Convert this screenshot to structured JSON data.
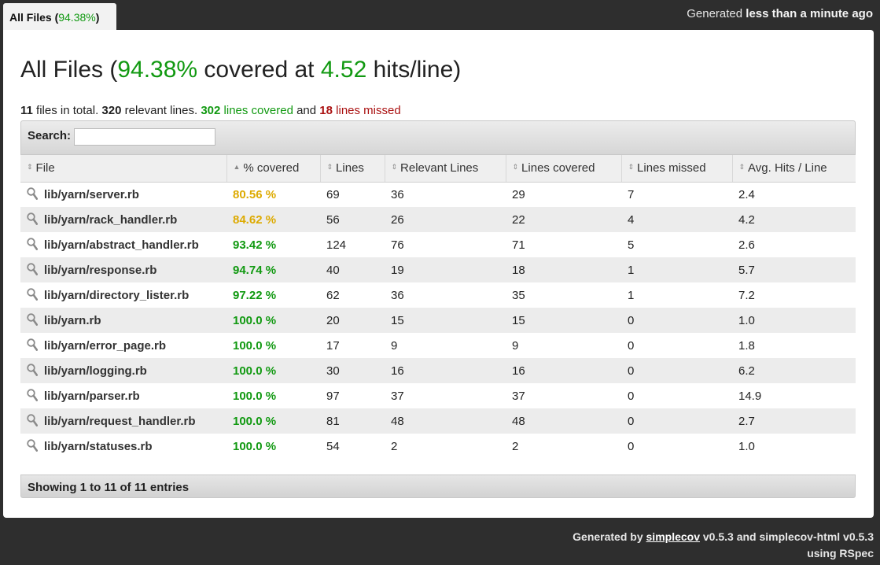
{
  "tab": {
    "label_prefix": "All Files (",
    "pct": "94.38%",
    "label_suffix": ")"
  },
  "generated": {
    "prefix": "Generated",
    "time": "less than a minute ago"
  },
  "heading": {
    "prefix": "All Files (",
    "pct": "94.38%",
    "middle": " covered at ",
    "hits": "4.52",
    "suffix": " hits/line)"
  },
  "summary": {
    "files_count": "11",
    "files_text": " files in total. ",
    "relevant_count": "320",
    "relevant_text": " relevant lines. ",
    "covered_count": "302",
    "covered_text": " lines covered",
    "and_text": " and ",
    "missed_count": "18",
    "missed_text": " lines missed"
  },
  "search": {
    "label": "Search:",
    "value": ""
  },
  "table": {
    "columns": [
      "File",
      "% covered",
      "Lines",
      "Relevant Lines",
      "Lines covered",
      "Lines missed",
      "Avg. Hits / Line"
    ],
    "sort_icons": [
      "⇕",
      "▲",
      "⇕",
      "⇕",
      "⇕",
      "⇕",
      "⇕"
    ],
    "rows": [
      {
        "file": "lib/yarn/server.rb",
        "pct": "80.56 %",
        "lines": "69",
        "relevant": "36",
        "covered": "29",
        "missed": "7",
        "avg": "2.4"
      },
      {
        "file": "lib/yarn/rack_handler.rb",
        "pct": "84.62 %",
        "lines": "56",
        "relevant": "26",
        "covered": "22",
        "missed": "4",
        "avg": "4.2"
      },
      {
        "file": "lib/yarn/abstract_handler.rb",
        "pct": "93.42 %",
        "lines": "124",
        "relevant": "76",
        "covered": "71",
        "missed": "5",
        "avg": "2.6"
      },
      {
        "file": "lib/yarn/response.rb",
        "pct": "94.74 %",
        "lines": "40",
        "relevant": "19",
        "covered": "18",
        "missed": "1",
        "avg": "5.7"
      },
      {
        "file": "lib/yarn/directory_lister.rb",
        "pct": "97.22 %",
        "lines": "62",
        "relevant": "36",
        "covered": "35",
        "missed": "1",
        "avg": "7.2"
      },
      {
        "file": "lib/yarn.rb",
        "pct": "100.0 %",
        "lines": "20",
        "relevant": "15",
        "covered": "15",
        "missed": "0",
        "avg": "1.0"
      },
      {
        "file": "lib/yarn/error_page.rb",
        "pct": "100.0 %",
        "lines": "17",
        "relevant": "9",
        "covered": "9",
        "missed": "0",
        "avg": "1.8"
      },
      {
        "file": "lib/yarn/logging.rb",
        "pct": "100.0 %",
        "lines": "30",
        "relevant": "16",
        "covered": "16",
        "missed": "0",
        "avg": "6.2"
      },
      {
        "file": "lib/yarn/parser.rb",
        "pct": "100.0 %",
        "lines": "97",
        "relevant": "37",
        "covered": "37",
        "missed": "0",
        "avg": "14.9"
      },
      {
        "file": "lib/yarn/request_handler.rb",
        "pct": "100.0 %",
        "lines": "81",
        "relevant": "48",
        "covered": "48",
        "missed": "0",
        "avg": "2.7"
      },
      {
        "file": "lib/yarn/statuses.rb",
        "pct": "100.0 %",
        "lines": "54",
        "relevant": "2",
        "covered": "2",
        "missed": "0",
        "avg": "1.0"
      }
    ]
  },
  "info": "Showing 1 to 11 of 11 entries",
  "footer": {
    "prefix": "Generated by ",
    "link": "simplecov",
    "middle": " v0.5.3 and simplecov-html v0.5.3",
    "line2": "using RSpec"
  },
  "colors": {
    "green": "#119911",
    "yellow": "#ddaa00",
    "red": "#aa1111",
    "background": "#2e2e2e"
  },
  "icons": {
    "row_icon": "magnifier-icon"
  }
}
